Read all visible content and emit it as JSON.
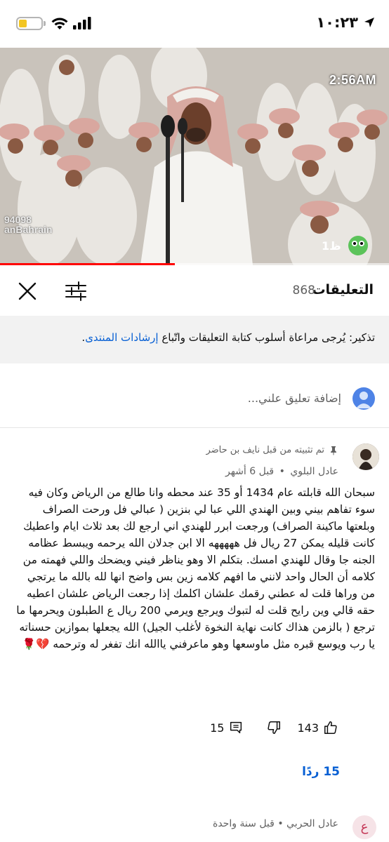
{
  "status": {
    "time": "١٠:٢٣",
    "battery_fraction": 0.35,
    "colors": {
      "battery": "#f3c623"
    }
  },
  "video": {
    "timestamp": "2:56AM",
    "watermark_line1": "94098",
    "watermark_line2": "anBahrain",
    "progress_fraction": 0.45,
    "colors": {
      "progress": "#ff0000"
    }
  },
  "comments_panel": {
    "title": "التعليقات",
    "count": "868",
    "close_icon": "close-icon",
    "filter_icon": "sliders-icon"
  },
  "reminder": {
    "text": "تذكير: يُرجى مراعاة أسلوب كتابة التعليقات واتّباع ",
    "link": "إرشادات المنتدى",
    "end": "."
  },
  "add_comment": {
    "placeholder": "إضافة تعليق علني..."
  },
  "comment_1": {
    "pinned_label": "تم تثبيته من قبل نايف بن حاضر",
    "author": "عادل البلوي",
    "separator": "•",
    "time": "قبل 6 أشهر",
    "text": "سبحان الله قابلته عام 1434 أو 35 عند محطه وانا طالع من الرياض وكان فيه سوء تفاهم بيني وبين الهندي اللي عبا لي بنزين ( عبالي فل ورحت الصراف وبلعتها ماكينة الصراف) ورجعت ابرر للهندي اني ارجع لك بعد ثلاث ايام واعطيك كانت قليله يمكن 27 ريال فل هههههه الا ابن جدلان الله يرحمه ويبسط عظامه الجنه جا وقال للهندي امسك. بتكلم الا وهو يناظر فيني ويضحك واللي فهمته من كلامه أن الحال واحد لانني ما افهم كلامه زين بس واضح انها لله بالله ما يرتجي من وراها قلت له عطني رقمك علشان اكلمك إذا رجعت الرياض علشان اعطيه حقه قالي وين رايح قلت له لتبوك ويرجع ويرمي 200 ريال ع الطبلون ويحرمها ما ترجع ( بالزمن هذاك كانت نهاية النخوة لأغلب الجيل) الله يجعلها بموازين حسناته يا رب ويوسع قبره مثل ماوسعها وهو ماعرفني ياالله انك تفغر له وترحمه 💔🌹",
    "likes": "143",
    "replies_count": "15",
    "replies_link": "15 ردًا"
  },
  "comment_2": {
    "avatar_letter": "ع",
    "author": "عادل الحربي",
    "separator": "•",
    "time": "قبل سنة واحدة"
  },
  "colors": {
    "link": "#065fd4",
    "secondary_text": "#606060",
    "reminder_bg": "#f2f2f2"
  }
}
